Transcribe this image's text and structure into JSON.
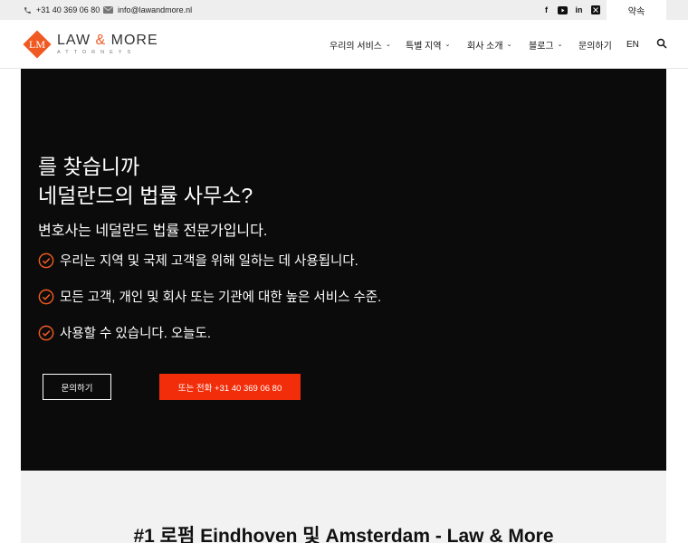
{
  "topbar": {
    "phone": "+31 40 369 06 80",
    "email": "info@lawandmore.nl",
    "social_icons": [
      "facebook-icon",
      "youtube-icon",
      "linkedin-icon",
      "x-icon"
    ],
    "appointment_label": "약속"
  },
  "logo": {
    "mark": "LM",
    "name_left": "LAW",
    "name_amp": "&",
    "name_right": "MORE",
    "tagline": "ATTORNEYS"
  },
  "nav": {
    "items": [
      {
        "label": "우리의 서비스",
        "dropdown": true
      },
      {
        "label": "특별 지역",
        "dropdown": true
      },
      {
        "label": "회사 소개",
        "dropdown": true
      },
      {
        "label": "블로그",
        "dropdown": true
      },
      {
        "label": "문의하기",
        "dropdown": false
      },
      {
        "label": "EN",
        "dropdown": false
      }
    ]
  },
  "hero": {
    "title_line1": "를 찾습니까",
    "title_line2": "네덜란드의 법률 사무소?",
    "subtitle": "변호사는 네덜란드 법률 전문가입니다.",
    "checks": [
      "우리는 지역 및 국제 고객을 위해 일하는 데 사용됩니다.",
      "모든 고객, 개인 및 회사 또는 기관에 대한 높은 서비스 수준.",
      "사용할 수 있습니다. 오늘도."
    ],
    "contact_button": "문의하기",
    "call_button": "또는 전화 +31 40 369 06 80"
  },
  "section": {
    "title": "#1 로펌 Eindhoven 및 Amsterdam - Law & More"
  },
  "colors": {
    "accent": "#f05a22",
    "cta": "#f22d0a",
    "hero_bg": "#0b0b0b",
    "topbar_bg": "#eeeeee"
  }
}
